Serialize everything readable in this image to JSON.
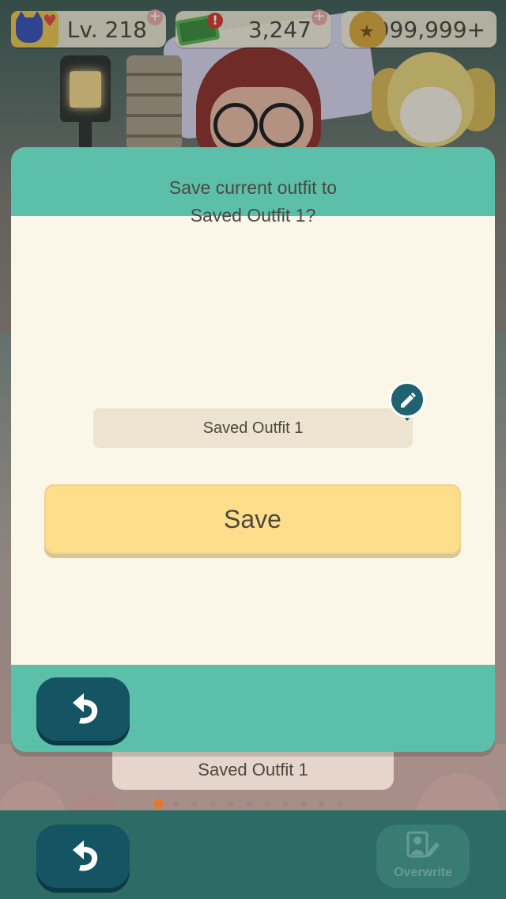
{
  "hud": {
    "level_label": "Lv. 218",
    "tickets": "3,247",
    "bells": "9,999,999+"
  },
  "dialog": {
    "prompt_line1": "Save current outfit to",
    "prompt_line2": "Saved Outfit 1?",
    "outfit_name": "Saved Outfit 1",
    "save_label": "Save"
  },
  "background": {
    "outfit_label": "Saved Outfit 1",
    "pager_total": 11,
    "pager_active": 1
  },
  "bottom_bar": {
    "overwrite_label": "Overwrite"
  },
  "colors": {
    "teal": "#5bbfa9",
    "dark_teal": "#145463",
    "cream": "#faf6e8",
    "save_yellow": "#fede8a"
  },
  "icons": {
    "back": "undo-arrow-icon",
    "edit": "pencil-icon",
    "overwrite": "overwrite-icon"
  }
}
